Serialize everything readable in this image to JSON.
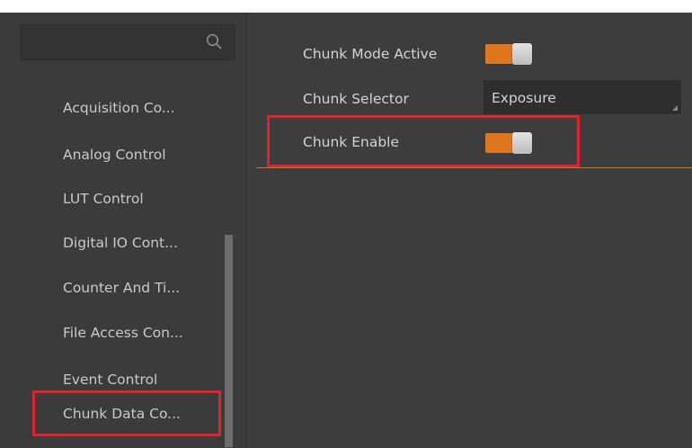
{
  "sidebar": {
    "search": {
      "placeholder": "",
      "icon": "search-icon"
    },
    "items": [
      {
        "label": "Acquisition Co..."
      },
      {
        "label": "Analog Control"
      },
      {
        "label": "LUT Control"
      },
      {
        "label": "Digital IO Cont..."
      },
      {
        "label": "Counter And Ti..."
      },
      {
        "label": "File Access Con..."
      },
      {
        "label": "Event Control"
      },
      {
        "label": "Chunk Data Co...",
        "selected": true
      }
    ]
  },
  "properties": {
    "chunk_mode_active": {
      "label": "Chunk Mode Active",
      "value": true
    },
    "chunk_selector": {
      "label": "Chunk Selector",
      "value": "Exposure"
    },
    "chunk_enable": {
      "label": "Chunk Enable",
      "value": true
    }
  },
  "colors": {
    "toggle_on": "#e0751f",
    "highlight": "#e0222a",
    "panel_bg": "#3c3c3c",
    "text": "#d3d3d3"
  }
}
